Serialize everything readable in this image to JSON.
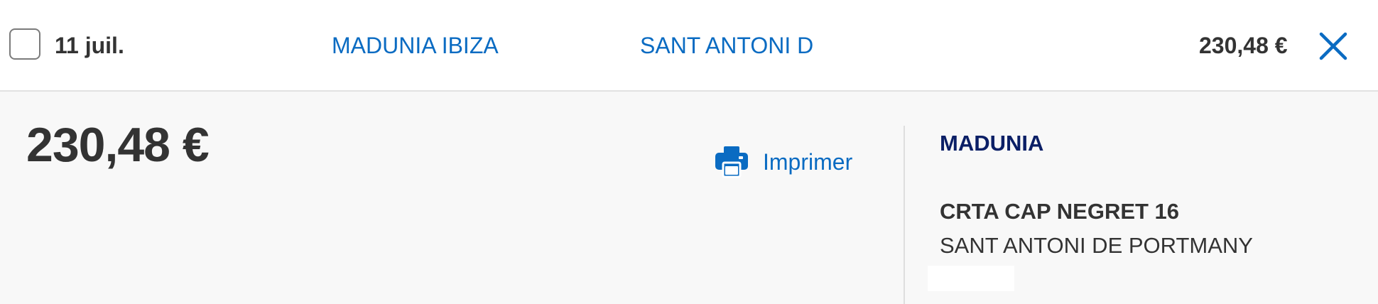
{
  "transaction": {
    "date": "11 juil.",
    "merchant_link": "MADUNIA IBIZA",
    "city_link": "SANT ANTONI D",
    "amount": "230,48 €"
  },
  "details": {
    "amount": "230,48 €",
    "print_label": "Imprimer",
    "merchant_name": "MADUNIA",
    "address_line1": "CRTA CAP NEGRET 16",
    "address_line2": "SANT ANTONI DE PORTMANY"
  },
  "icons": {
    "close": "close-icon",
    "print": "printer-icon"
  },
  "colors": {
    "link": "#0a6bc2",
    "merchant_name": "#0b1f66",
    "text": "#333333",
    "panel_bg": "#f8f8f8"
  }
}
